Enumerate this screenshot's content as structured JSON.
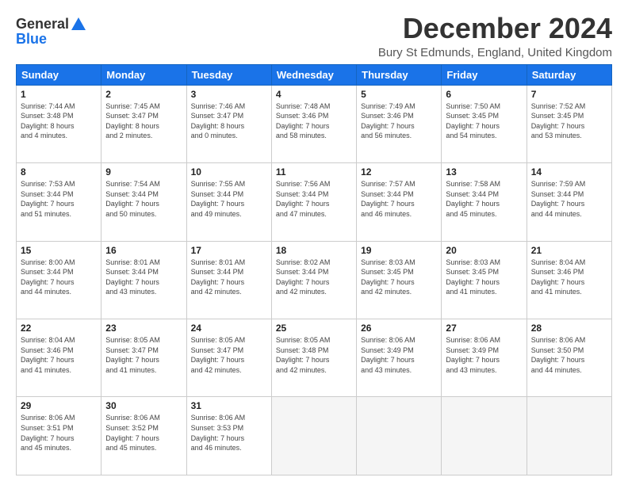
{
  "header": {
    "logo_line1": "General",
    "logo_line2": "Blue",
    "month_title": "December 2024",
    "subtitle": "Bury St Edmunds, England, United Kingdom"
  },
  "weekdays": [
    "Sunday",
    "Monday",
    "Tuesday",
    "Wednesday",
    "Thursday",
    "Friday",
    "Saturday"
  ],
  "weeks": [
    [
      {
        "day": "1",
        "info": "Sunrise: 7:44 AM\nSunset: 3:48 PM\nDaylight: 8 hours\nand 4 minutes."
      },
      {
        "day": "2",
        "info": "Sunrise: 7:45 AM\nSunset: 3:47 PM\nDaylight: 8 hours\nand 2 minutes."
      },
      {
        "day": "3",
        "info": "Sunrise: 7:46 AM\nSunset: 3:47 PM\nDaylight: 8 hours\nand 0 minutes."
      },
      {
        "day": "4",
        "info": "Sunrise: 7:48 AM\nSunset: 3:46 PM\nDaylight: 7 hours\nand 58 minutes."
      },
      {
        "day": "5",
        "info": "Sunrise: 7:49 AM\nSunset: 3:46 PM\nDaylight: 7 hours\nand 56 minutes."
      },
      {
        "day": "6",
        "info": "Sunrise: 7:50 AM\nSunset: 3:45 PM\nDaylight: 7 hours\nand 54 minutes."
      },
      {
        "day": "7",
        "info": "Sunrise: 7:52 AM\nSunset: 3:45 PM\nDaylight: 7 hours\nand 53 minutes."
      }
    ],
    [
      {
        "day": "8",
        "info": "Sunrise: 7:53 AM\nSunset: 3:44 PM\nDaylight: 7 hours\nand 51 minutes."
      },
      {
        "day": "9",
        "info": "Sunrise: 7:54 AM\nSunset: 3:44 PM\nDaylight: 7 hours\nand 50 minutes."
      },
      {
        "day": "10",
        "info": "Sunrise: 7:55 AM\nSunset: 3:44 PM\nDaylight: 7 hours\nand 49 minutes."
      },
      {
        "day": "11",
        "info": "Sunrise: 7:56 AM\nSunset: 3:44 PM\nDaylight: 7 hours\nand 47 minutes."
      },
      {
        "day": "12",
        "info": "Sunrise: 7:57 AM\nSunset: 3:44 PM\nDaylight: 7 hours\nand 46 minutes."
      },
      {
        "day": "13",
        "info": "Sunrise: 7:58 AM\nSunset: 3:44 PM\nDaylight: 7 hours\nand 45 minutes."
      },
      {
        "day": "14",
        "info": "Sunrise: 7:59 AM\nSunset: 3:44 PM\nDaylight: 7 hours\nand 44 minutes."
      }
    ],
    [
      {
        "day": "15",
        "info": "Sunrise: 8:00 AM\nSunset: 3:44 PM\nDaylight: 7 hours\nand 44 minutes."
      },
      {
        "day": "16",
        "info": "Sunrise: 8:01 AM\nSunset: 3:44 PM\nDaylight: 7 hours\nand 43 minutes."
      },
      {
        "day": "17",
        "info": "Sunrise: 8:01 AM\nSunset: 3:44 PM\nDaylight: 7 hours\nand 42 minutes."
      },
      {
        "day": "18",
        "info": "Sunrise: 8:02 AM\nSunset: 3:44 PM\nDaylight: 7 hours\nand 42 minutes."
      },
      {
        "day": "19",
        "info": "Sunrise: 8:03 AM\nSunset: 3:45 PM\nDaylight: 7 hours\nand 42 minutes."
      },
      {
        "day": "20",
        "info": "Sunrise: 8:03 AM\nSunset: 3:45 PM\nDaylight: 7 hours\nand 41 minutes."
      },
      {
        "day": "21",
        "info": "Sunrise: 8:04 AM\nSunset: 3:46 PM\nDaylight: 7 hours\nand 41 minutes."
      }
    ],
    [
      {
        "day": "22",
        "info": "Sunrise: 8:04 AM\nSunset: 3:46 PM\nDaylight: 7 hours\nand 41 minutes."
      },
      {
        "day": "23",
        "info": "Sunrise: 8:05 AM\nSunset: 3:47 PM\nDaylight: 7 hours\nand 41 minutes."
      },
      {
        "day": "24",
        "info": "Sunrise: 8:05 AM\nSunset: 3:47 PM\nDaylight: 7 hours\nand 42 minutes."
      },
      {
        "day": "25",
        "info": "Sunrise: 8:05 AM\nSunset: 3:48 PM\nDaylight: 7 hours\nand 42 minutes."
      },
      {
        "day": "26",
        "info": "Sunrise: 8:06 AM\nSunset: 3:49 PM\nDaylight: 7 hours\nand 43 minutes."
      },
      {
        "day": "27",
        "info": "Sunrise: 8:06 AM\nSunset: 3:49 PM\nDaylight: 7 hours\nand 43 minutes."
      },
      {
        "day": "28",
        "info": "Sunrise: 8:06 AM\nSunset: 3:50 PM\nDaylight: 7 hours\nand 44 minutes."
      }
    ],
    [
      {
        "day": "29",
        "info": "Sunrise: 8:06 AM\nSunset: 3:51 PM\nDaylight: 7 hours\nand 45 minutes."
      },
      {
        "day": "30",
        "info": "Sunrise: 8:06 AM\nSunset: 3:52 PM\nDaylight: 7 hours\nand 45 minutes."
      },
      {
        "day": "31",
        "info": "Sunrise: 8:06 AM\nSunset: 3:53 PM\nDaylight: 7 hours\nand 46 minutes."
      },
      {
        "day": "",
        "info": ""
      },
      {
        "day": "",
        "info": ""
      },
      {
        "day": "",
        "info": ""
      },
      {
        "day": "",
        "info": ""
      }
    ]
  ]
}
